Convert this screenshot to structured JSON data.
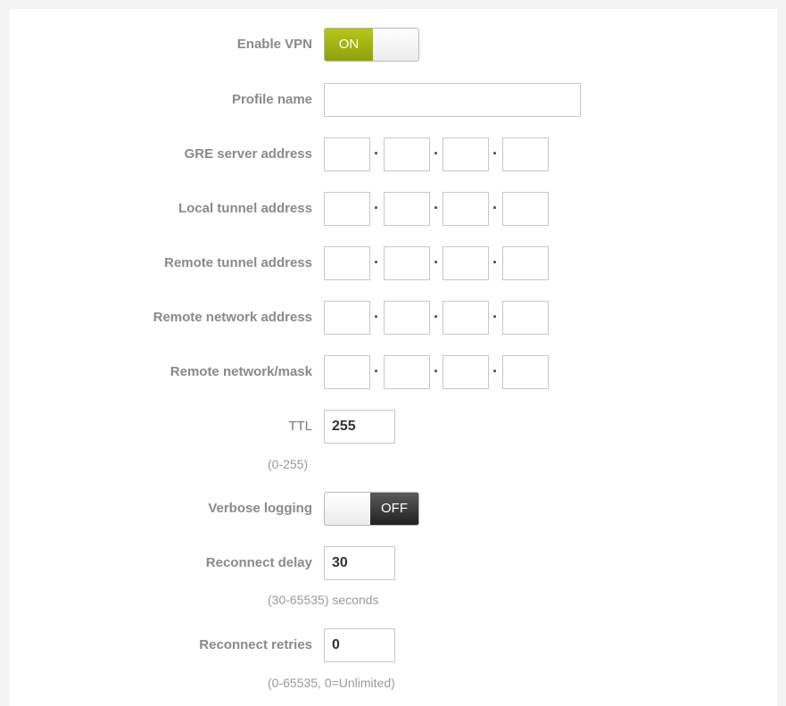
{
  "form": {
    "enable_vpn": {
      "label": "Enable VPN",
      "state": "ON"
    },
    "profile_name": {
      "label": "Profile name",
      "value": ""
    },
    "gre_server": {
      "label": "GRE server address",
      "octets": [
        "",
        "",
        "",
        ""
      ]
    },
    "local_tunnel": {
      "label": "Local tunnel address",
      "octets": [
        "",
        "",
        "",
        ""
      ]
    },
    "remote_tunnel": {
      "label": "Remote tunnel address",
      "octets": [
        "",
        "",
        "",
        ""
      ]
    },
    "remote_network": {
      "label": "Remote network address",
      "octets": [
        "",
        "",
        "",
        ""
      ]
    },
    "remote_mask": {
      "label": "Remote network/mask",
      "octets": [
        "",
        "",
        "",
        ""
      ]
    },
    "ttl": {
      "label": "TTL",
      "value": "255",
      "hint": "(0-255)"
    },
    "verbose_logging": {
      "label": "Verbose logging",
      "state": "OFF"
    },
    "reconnect_delay": {
      "label": "Reconnect delay",
      "value": "30",
      "hint": "(30-65535) seconds"
    },
    "reconnect_retries": {
      "label": "Reconnect retries",
      "value": "0",
      "hint": "(0-65535, 0=Unlimited)"
    }
  },
  "colors": {
    "toggle_on": "#a3b514",
    "toggle_off": "#333333",
    "label_text": "#8a8a8a"
  }
}
